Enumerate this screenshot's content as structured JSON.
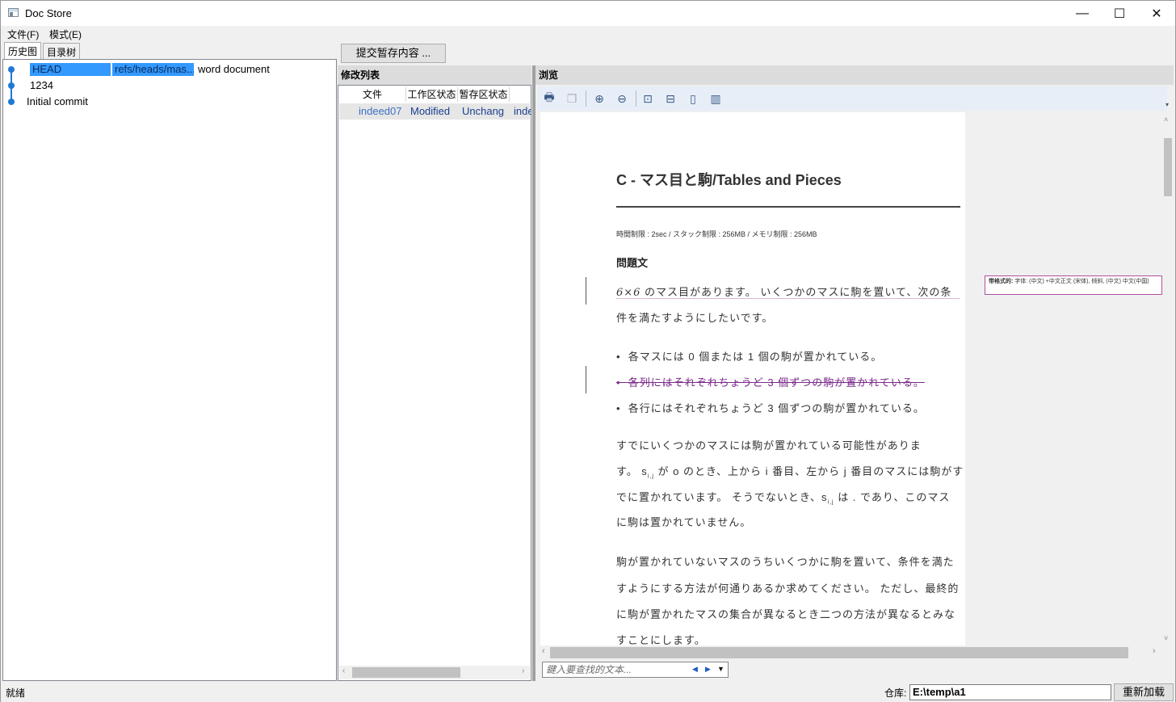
{
  "window": {
    "title": "Doc Store",
    "minimize": "—",
    "maximize": "☐",
    "close": "✕"
  },
  "menu": {
    "file": "文件(F)",
    "mode": "模式(E)"
  },
  "left_tabs": {
    "history": "历史图",
    "tree": "目录树"
  },
  "history": {
    "rows": [
      {
        "label": "HEAD",
        "ref": "refs/heads/mas...",
        "message": "word document"
      },
      {
        "label": "1234"
      },
      {
        "label": "Initial commit"
      }
    ]
  },
  "commit_button": "提交暂存内容 ...",
  "changes": {
    "title": "修改列表",
    "columns": [
      "文件",
      "工作区状态",
      "暂存区状态"
    ],
    "rows": [
      {
        "file": "indeed07",
        "worktree": "Modified",
        "index": "Unchang",
        "extra": "inde"
      }
    ]
  },
  "viewer": {
    "title": "浏览",
    "toolbar": [
      "print-icon",
      "copy-icon",
      "zoom-in-icon",
      "zoom-out-icon",
      "fit-page-icon",
      "fit-width-icon",
      "single-page-icon",
      "two-page-icon"
    ],
    "find_placeholder": "鍵入要查找的文本..."
  },
  "document": {
    "title": "C - マス目と駒/Tables and Pieces",
    "limits": "時間制限 : 2sec / スタック制限 : 256MB / メモリ制限 : 256MB",
    "heading": "問題文",
    "p1_line1_math": "6×6",
    "p1_line1_text": " のマス目があります。 いくつかのマスに駒を置いて、次の条",
    "p1_line2": "件を満たすようにしたいです。",
    "bullets": [
      "各マスには 0 個または 1 個の駒が置かれている。",
      "各列にはそれぞれちょうど 3 個ずつの駒が置かれている。",
      "各行にはそれぞれちょうど 3 個ずつの駒が置かれている。"
    ],
    "p2_lines": [
      "すでにいくつかのマスには駒が置かれている可能性がありま",
      "す。 s",
      "でに置かれています。 そうでないとき、s",
      "に駒は置かれていません。"
    ],
    "p2_line2_rest": " が o のとき、上から i 番目、左から j 番目のマスには駒がす",
    "p2_line3_rest": " は . であり、このマス",
    "sub_ij": "i,j",
    "p3_lines": [
      "駒が置かれていないマスのうちいくつかに駒を置いて、条件を満た",
      "すようにする方法が何通りあるか求めてください。 ただし、最終的",
      "に駒が置かれたマスの集合が異なるとき二つの方法が異なるとみな",
      "すことにします。"
    ],
    "comment_label": "带格式的:",
    "comment_text": "字体: (中文) +中文正文 (宋体), 倾斜, (中文) 中文(中国)"
  },
  "status": {
    "ready": "就绪",
    "repo_label": "仓库:",
    "repo_path": "E:\\temp\\a1",
    "reload": "重新加载"
  }
}
